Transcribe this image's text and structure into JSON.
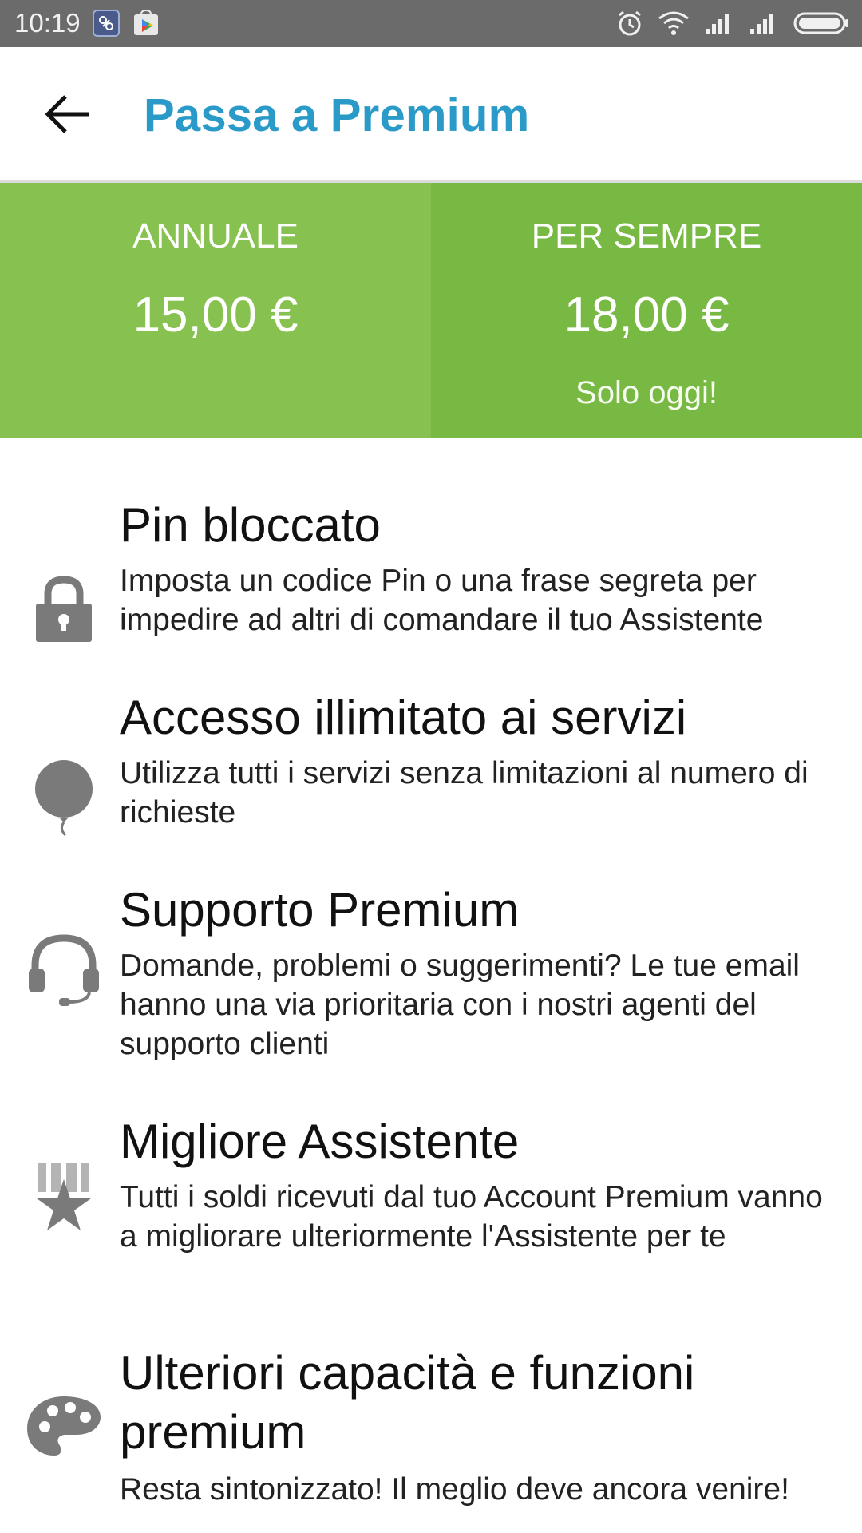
{
  "status_bar": {
    "time": "10:19",
    "left_icons": [
      "screenshot-app-icon",
      "play-store-icon"
    ],
    "right_icons": [
      "alarm-icon",
      "wifi-icon",
      "signal-icon",
      "signal-icon",
      "battery-icon"
    ]
  },
  "app_bar": {
    "title": "Passa a Premium",
    "back_icon": "arrow-back-icon"
  },
  "plans": [
    {
      "name": "ANNUALE",
      "price": "15,00 €",
      "note": ""
    },
    {
      "name": "PER SEMPRE",
      "price": "18,00 €",
      "note": "Solo oggi!"
    }
  ],
  "colors": {
    "title": "#2a9ac8",
    "plan_annual": "#87c251",
    "plan_forever": "#78b943",
    "icon_gray": "#7a7a7a"
  },
  "features": [
    {
      "icon": "lock-icon",
      "title": "Pin bloccato",
      "description": "Imposta un codice Pin o una frase segreta per impedire ad altri di comandare il tuo Assistente"
    },
    {
      "icon": "balloon-icon",
      "title": "Accesso illimitato ai servizi",
      "description": "Utilizza tutti i servizi senza limitazioni al numero di richieste"
    },
    {
      "icon": "headset-icon",
      "title": "Supporto Premium",
      "description": "Domande, problemi o suggerimenti? Le tue email hanno una via prioritaria con i nostri agenti del supporto clienti"
    },
    {
      "icon": "medal-star-icon",
      "title": "Migliore Assistente",
      "description": "Tutti i soldi ricevuti dal tuo Account Premium vanno a migliorare ulteriormente l'Assistente per te"
    },
    {
      "icon": "palette-icon",
      "title": "Ulteriori capacità e funzioni premium",
      "description": "Resta sintonizzato! Il meglio deve ancora venire!"
    }
  ]
}
